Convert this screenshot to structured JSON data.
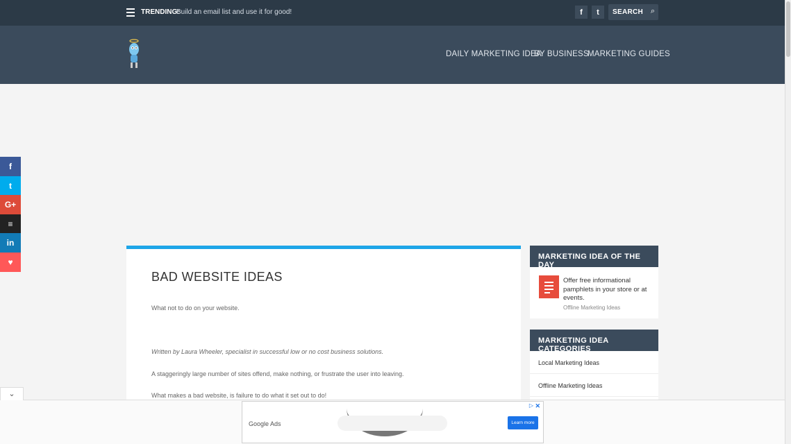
{
  "topbar": {
    "trending_label": "TRENDING:",
    "trending_text": "Build an email list and use it for good!",
    "facebook": "f",
    "twitter": "t",
    "search_label": "SEARCH"
  },
  "nav": {
    "items": [
      "DAILY MARKETING IDEA",
      "BY BUSINESS",
      "MARKETING GUIDES"
    ]
  },
  "share": {
    "items": [
      {
        "name": "facebook",
        "glyph": "f",
        "color": "#3b5998"
      },
      {
        "name": "twitter",
        "glyph": "t",
        "color": "#00aced"
      },
      {
        "name": "google-plus",
        "glyph": "G+",
        "color": "#dd4b39"
      },
      {
        "name": "buffer",
        "glyph": "≡",
        "color": "#222222"
      },
      {
        "name": "linkedin",
        "glyph": "in",
        "color": "#127bb6"
      },
      {
        "name": "love",
        "glyph": "♥",
        "color": "#ff5858"
      }
    ]
  },
  "article": {
    "title": "BAD WEBSITE IDEAS",
    "subtitle": "What not to do on your website.",
    "byline": "Written by Laura Wheeler, specialist in successful low or no cost business solutions.",
    "p1": "A staggeringly large number of sites offend, make nothing, or frustrate the user into leaving.",
    "p2": "What makes a bad website, is failure to do what it set out to do!"
  },
  "widget_idea": {
    "title": "MARKETING IDEA OF THE DAY",
    "idea": "Offer free informational pamphlets in your store or at events.",
    "category": "Offline Marketing Ideas"
  },
  "widget_categories": {
    "title": "MARKETING IDEA CATEGORIES",
    "items": [
      "Local Marketing Ideas",
      "Offline Marketing Ideas"
    ]
  },
  "ad": {
    "logo": "Google Ads",
    "button": "Learn more",
    "close": "✕",
    "play": "▷"
  },
  "colors": {
    "topbar": "#2c3a47",
    "header": "#3b4b5c",
    "accent_blue": "#1ea5e8",
    "doc_red": "#e74c3c"
  }
}
